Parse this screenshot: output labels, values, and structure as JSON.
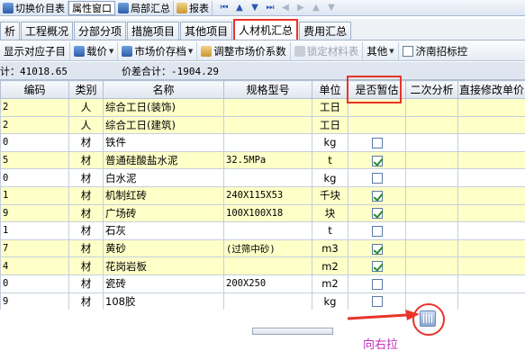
{
  "topbar": {
    "items": [
      {
        "label": "切换价目表",
        "icon": "switch-icon"
      },
      {
        "label": "属性窗口",
        "icon": "properties-icon"
      },
      {
        "label": "局部汇总",
        "icon": "summary-icon"
      },
      {
        "label": "报表",
        "icon": "report-icon"
      }
    ]
  },
  "tabs": [
    {
      "label": "析"
    },
    {
      "label": "工程概况"
    },
    {
      "label": "分部分项"
    },
    {
      "label": "措施项目"
    },
    {
      "label": "其他项目"
    },
    {
      "label": "人材机汇总",
      "active": true
    },
    {
      "label": "费用汇总"
    }
  ],
  "toolbar2": {
    "show_child": "显示对应子目",
    "load_price": "载价",
    "market_price_save": "市场价存档",
    "adjust_coeff": "调整市场价系数",
    "lock_material": "锁定材料表",
    "other": "其他",
    "jinan_bid": "济南招标控"
  },
  "summary": {
    "total": "计：41018.65",
    "diff_total": "价差合计：-1904.29"
  },
  "table": {
    "headers": [
      "编码",
      "类别",
      "名称",
      "规格型号",
      "单位",
      "是否暂估",
      "二次分析",
      "直接修改单价"
    ],
    "rows": [
      {
        "code": "2",
        "cat": "人",
        "name": "综合工日(装饰)",
        "spec": "",
        "unit": "工日",
        "est": null,
        "yellow": true
      },
      {
        "code": "2",
        "cat": "人",
        "name": "综合工日(建筑)",
        "spec": "",
        "unit": "工日",
        "est": null,
        "yellow": true
      },
      {
        "code": "0",
        "cat": "材",
        "name": "铁件",
        "spec": "",
        "unit": "kg",
        "est": false,
        "yellow": false
      },
      {
        "code": "5",
        "cat": "材",
        "name": "普通硅酸盐水泥",
        "spec": "32.5MPa",
        "unit": "t",
        "est": true,
        "yellow": true
      },
      {
        "code": "0",
        "cat": "材",
        "name": "白水泥",
        "spec": "",
        "unit": "kg",
        "est": false,
        "yellow": false
      },
      {
        "code": "1",
        "cat": "材",
        "name": "机制红砖",
        "spec": "240X115X53",
        "unit": "千块",
        "est": true,
        "yellow": true
      },
      {
        "code": "9",
        "cat": "材",
        "name": "广场砖",
        "spec": "100X100X18",
        "unit": "块",
        "est": true,
        "yellow": true
      },
      {
        "code": "1",
        "cat": "材",
        "name": "石灰",
        "spec": "",
        "unit": "t",
        "est": false,
        "yellow": false
      },
      {
        "code": "7",
        "cat": "材",
        "name": "黄砂",
        "spec": "(过筛中砂)",
        "unit": "m3",
        "est": true,
        "yellow": true
      },
      {
        "code": "4",
        "cat": "材",
        "name": "花岗岩板",
        "spec": "",
        "unit": "m2",
        "est": true,
        "yellow": true
      },
      {
        "code": "0",
        "cat": "材",
        "name": "瓷砖",
        "spec": "200X250",
        "unit": "m2",
        "est": false,
        "yellow": false
      },
      {
        "code": "9",
        "cat": "材",
        "name": "108胶",
        "spec": "",
        "unit": "kg",
        "est": false,
        "yellow": false
      }
    ]
  },
  "annotation": "向右拉",
  "colors": {
    "highlight": "#e8342a",
    "row_yellow": "#ffffc8",
    "annotation": "#c030c0"
  }
}
